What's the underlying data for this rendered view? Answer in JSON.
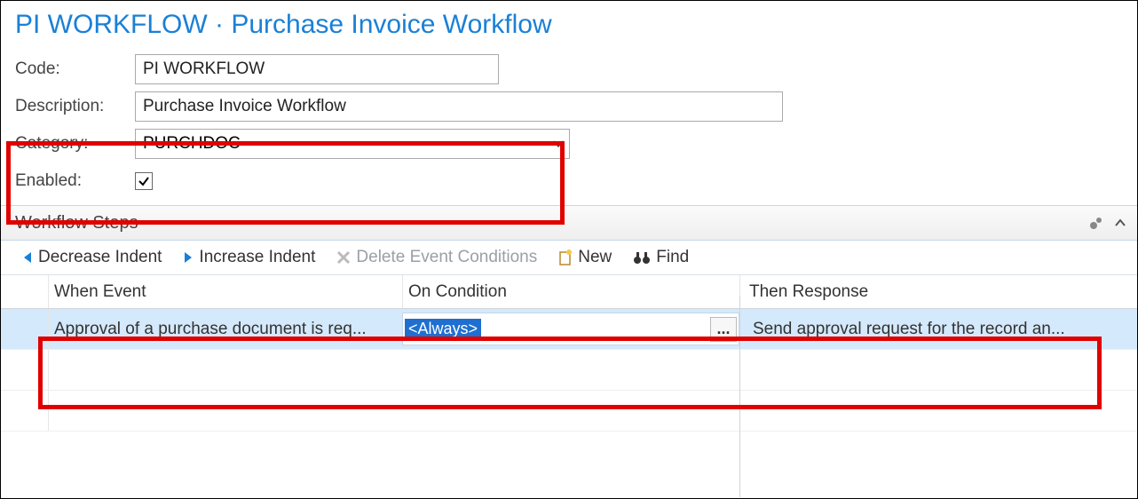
{
  "title_prefix": "PI WORKFLOW",
  "title_separator": " · ",
  "title_name": "Purchase Invoice Workflow",
  "form": {
    "code_label": "Code:",
    "code_value": "PI WORKFLOW",
    "description_label": "Description:",
    "description_value": "Purchase Invoice Workflow",
    "category_label": "Category:",
    "category_value": "PURCHDOC",
    "enabled_label": "Enabled:",
    "enabled_checked": true
  },
  "steps": {
    "section_title": "Workflow Steps",
    "toolbar": {
      "decrease_indent": "Decrease Indent",
      "increase_indent": "Increase Indent",
      "delete_event_conditions": "Delete Event Conditions",
      "new": "New",
      "find": "Find"
    },
    "columns": {
      "when_event": "When Event",
      "on_condition": "On Condition",
      "then_response": "Then Response"
    },
    "rows": [
      {
        "when_event": "Approval of a purchase document is req...",
        "on_condition": "<Always>",
        "then_response": "Send approval request for the record an...",
        "selected": true
      }
    ]
  },
  "ellipsis_label": "..."
}
